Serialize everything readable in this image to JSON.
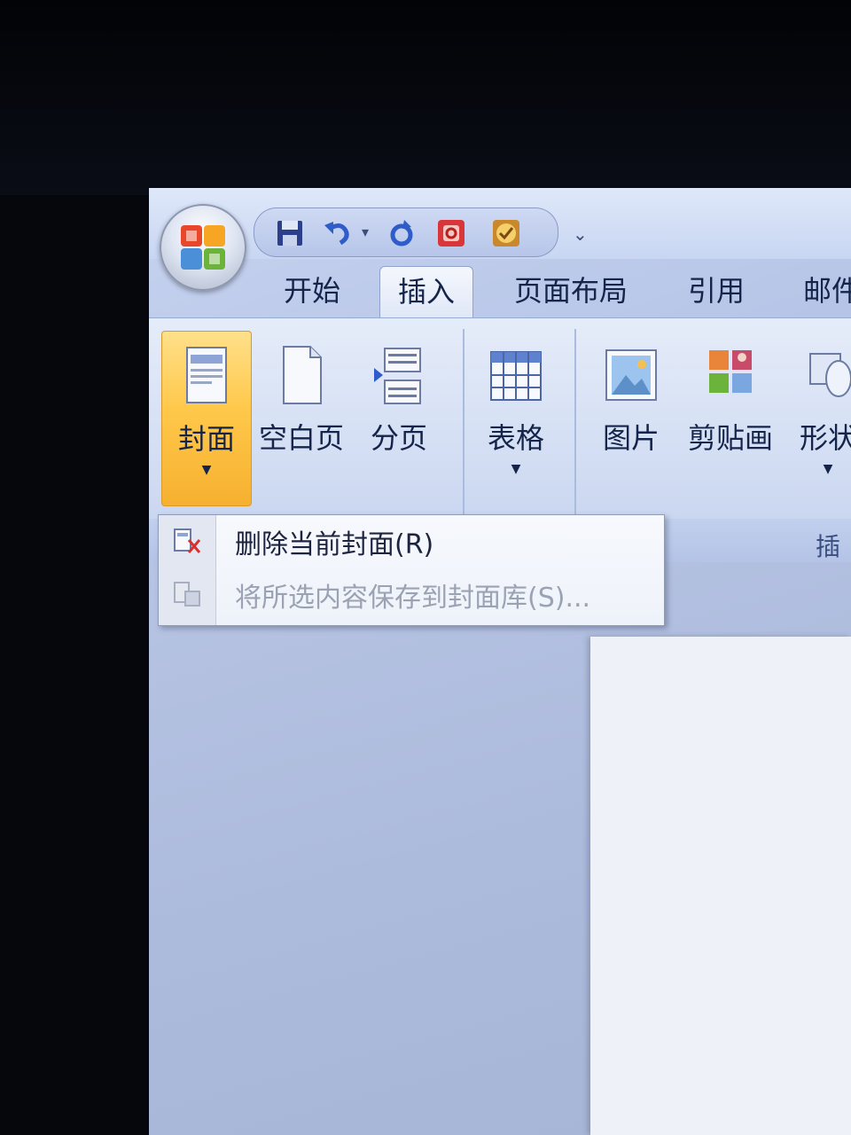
{
  "quick_access": {
    "icons": [
      "save-icon",
      "undo-icon",
      "dropdown-arrow-icon",
      "redo-icon",
      "print-preview-icon",
      "check-icon"
    ],
    "more_label": "⌄"
  },
  "tabs": [
    {
      "label": "开始",
      "active": false
    },
    {
      "label": "插入",
      "active": true
    },
    {
      "label": "页面布局",
      "active": false
    },
    {
      "label": "引用",
      "active": false
    },
    {
      "label": "邮件",
      "active": false
    }
  ],
  "ribbon": {
    "buttons": [
      {
        "label": "封面",
        "icon": "cover-page-icon",
        "hot": true,
        "has_dropdown": true
      },
      {
        "label": "空白页",
        "icon": "blank-page-icon",
        "hot": false,
        "has_dropdown": false
      },
      {
        "label": "分页",
        "icon": "page-break-icon",
        "hot": false,
        "has_dropdown": false
      },
      {
        "label": "表格",
        "icon": "table-icon",
        "hot": false,
        "has_dropdown": true
      },
      {
        "label": "图片",
        "icon": "picture-icon",
        "hot": false,
        "has_dropdown": false
      },
      {
        "label": "剪贴画",
        "icon": "clipart-icon",
        "hot": false,
        "has_dropdown": false
      },
      {
        "label": "形状",
        "icon": "shapes-icon",
        "hot": false,
        "has_dropdown": true
      }
    ],
    "group_label_illustrations": "插图"
  },
  "menu": {
    "items": [
      {
        "label": "删除当前封面(R)",
        "icon": "delete-cover-icon",
        "enabled": true
      },
      {
        "label": "将所选内容保存到封面库(S)...",
        "icon": "save-to-gallery-icon",
        "enabled": false
      }
    ]
  },
  "colors": {
    "accent_hot": "#ffc84a",
    "ribbon_bg": "#dfe7f7",
    "text": "#15244a",
    "disabled_text": "#9aa2b3"
  }
}
